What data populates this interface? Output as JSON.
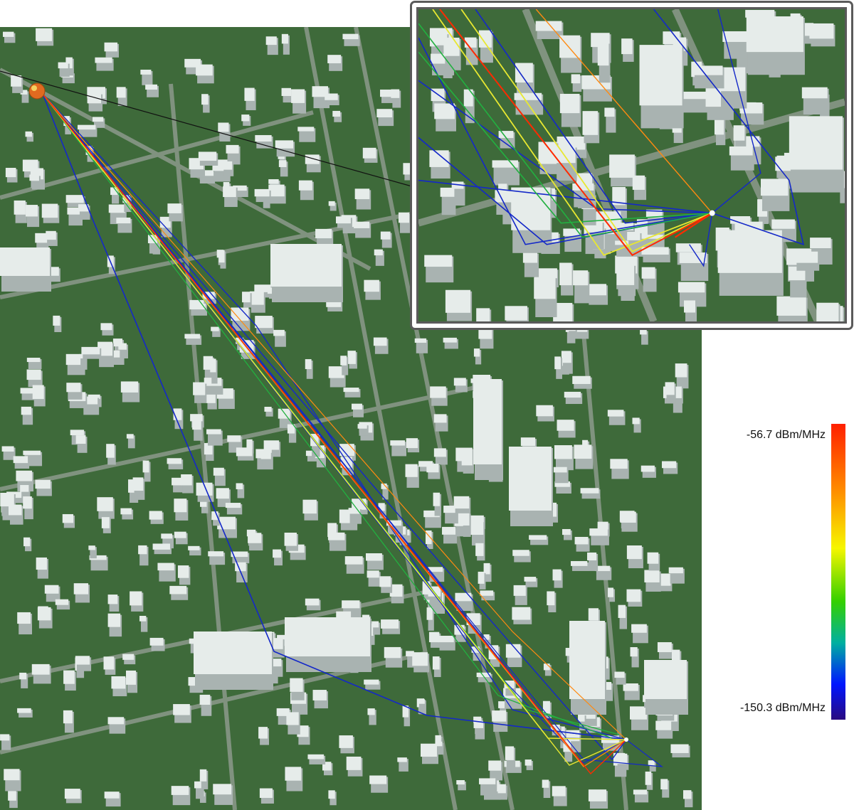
{
  "colorbar": {
    "max_label": "-56.7 dBm/MHz",
    "min_label": "-150.3 dBm/MHz",
    "stops": [
      "#ff2000",
      "#ff8a00",
      "#f6f600",
      "#34d000",
      "#00b0a0",
      "#0016ff",
      "#2a0a80"
    ]
  },
  "colors": {
    "ground": "#3e6a3a",
    "road": "#8c9a8c",
    "building_top": "#e6ecea",
    "building_side": "#a9b3b1",
    "ray_blue": "#1428c8",
    "ray_green": "#22b040",
    "ray_yellow": "#e8e830",
    "ray_orange": "#ff8a10",
    "ray_red": "#ff2a00"
  },
  "scene": {
    "transmitter": "transmitter-sphere",
    "receiver": "receiver-point"
  }
}
